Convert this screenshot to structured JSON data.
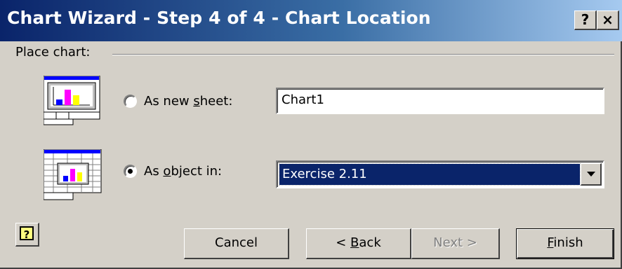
{
  "window": {
    "title": "Chart Wizard - Step 4 of 4 - Chart Location",
    "help_button": "?",
    "close_button": "×"
  },
  "group": {
    "label": "Place chart:"
  },
  "options": [
    {
      "label_before": "As new ",
      "label_mnemonic": "s",
      "label_after": "heet:",
      "selected": false,
      "value": "Chart1",
      "icon": "chart-sheet-icon"
    },
    {
      "label_before": "As ",
      "label_mnemonic": "o",
      "label_after": "bject in:",
      "selected": true,
      "value": "Exercise 2.11",
      "icon": "embedded-chart-icon"
    }
  ],
  "buttons": {
    "help": "?",
    "cancel": "Cancel",
    "back_prefix": "< ",
    "back_mnemonic": "B",
    "back_suffix": "ack",
    "next": "Next >",
    "next_enabled": false,
    "finish_mnemonic": "F",
    "finish_suffix": "inish"
  },
  "colors": {
    "title_bar_start": "#0a246a",
    "title_bar_end": "#a6caf0",
    "dialog_face": "#d4d0c8",
    "selection": "#0a246a"
  }
}
